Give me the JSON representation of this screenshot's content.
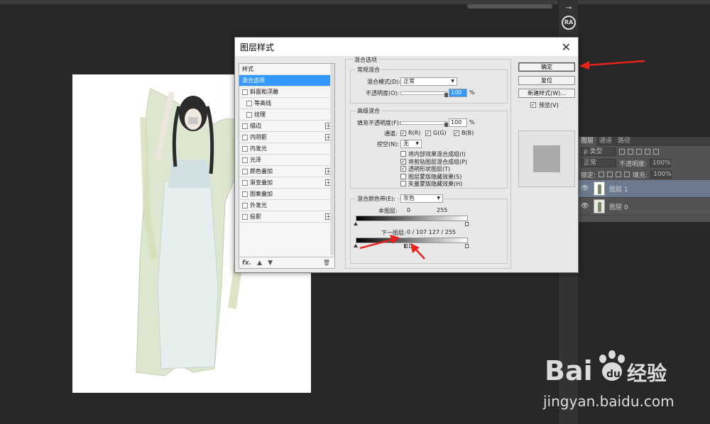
{
  "dialog": {
    "title": "图层样式",
    "close_glyph": "✕",
    "style_list": {
      "items": [
        {
          "label": "样式",
          "checkbox": false,
          "plus": false,
          "selected": false,
          "sub": false
        },
        {
          "label": "混合选项",
          "checkbox": false,
          "plus": false,
          "selected": true,
          "sub": false
        },
        {
          "label": "斜面和浮雕",
          "checkbox": true,
          "plus": false,
          "selected": false,
          "sub": false
        },
        {
          "label": "等高线",
          "checkbox": true,
          "plus": false,
          "selected": false,
          "sub": true
        },
        {
          "label": "纹理",
          "checkbox": true,
          "plus": false,
          "selected": false,
          "sub": true
        },
        {
          "label": "描边",
          "checkbox": true,
          "plus": true,
          "selected": false,
          "sub": false
        },
        {
          "label": "内阴影",
          "checkbox": true,
          "plus": true,
          "selected": false,
          "sub": false
        },
        {
          "label": "内发光",
          "checkbox": true,
          "plus": false,
          "selected": false,
          "sub": false
        },
        {
          "label": "光泽",
          "checkbox": true,
          "plus": false,
          "selected": false,
          "sub": false
        },
        {
          "label": "颜色叠加",
          "checkbox": true,
          "plus": true,
          "selected": false,
          "sub": false
        },
        {
          "label": "渐变叠加",
          "checkbox": true,
          "plus": true,
          "selected": false,
          "sub": false
        },
        {
          "label": "图案叠加",
          "checkbox": true,
          "plus": false,
          "selected": false,
          "sub": false
        },
        {
          "label": "外发光",
          "checkbox": true,
          "plus": false,
          "selected": false,
          "sub": false
        },
        {
          "label": "投影",
          "checkbox": true,
          "plus": true,
          "selected": false,
          "sub": false
        }
      ],
      "footer_fx": "fx.",
      "footer_up": "▲",
      "footer_down": "▼",
      "footer_trash": "🗑"
    },
    "blend": {
      "section_title": "混合选项",
      "general": {
        "title": "常规混合",
        "mode_label": "混合模式(D):",
        "mode_value": "正常",
        "opacity_label": "不透明度(O):",
        "opacity_value": "100",
        "percent": "%"
      },
      "advanced": {
        "title": "高级混合",
        "fill_label": "填充不透明度(F):",
        "fill_value": "100",
        "percent": "%",
        "channels_label": "通道:",
        "channel_r": "R(R)",
        "channel_g": "G(G)",
        "channel_b": "B(B)",
        "knockout_label": "挖空(N):",
        "knockout_value": "无",
        "options": [
          {
            "label": "将内部效果混合成组(I)",
            "checked": false
          },
          {
            "label": "将剪贴图层混合成组(P)",
            "checked": true
          },
          {
            "label": "透明形状图层(T)",
            "checked": true
          },
          {
            "label": "图层蒙版隐藏效果(S)",
            "checked": false
          },
          {
            "label": "矢量蒙版隐藏效果(H)",
            "checked": false
          }
        ]
      },
      "blend_if": {
        "label": "混合颜色带(E):",
        "value": "灰色",
        "this_layer_label": "本图层:",
        "this_layer_low": "0",
        "this_layer_high": "255",
        "underlying_label": "下一图层:",
        "underlying_values": "0  /  107    127  /  255"
      }
    },
    "buttons": {
      "ok": "确定",
      "reset": "复位",
      "new_style": "新建样式(W)...",
      "preview_label": "预览(V)",
      "preview_checked": true
    }
  },
  "layers_panel": {
    "tabs": [
      "图层",
      "通道",
      "路径"
    ],
    "filter_label": "ρ 类型",
    "blend_mode": "正常",
    "opacity_label": "不透明度:",
    "opacity_value": "100%",
    "lock_label": "锁定:",
    "fill_label": "填充:",
    "fill_value": "100%",
    "layers": [
      {
        "name": "图层 1",
        "selected": true
      },
      {
        "name": "图层 0",
        "selected": false
      }
    ]
  },
  "toolstrip": {
    "ra_label": "RA"
  },
  "watermark": {
    "brand": "Bai",
    "brand2": "du",
    "brand_cn": "经验",
    "url": "jingyan.baidu.com"
  },
  "colors": {
    "accent": "#3399ff",
    "arrow": "#e8231d",
    "bg": "#282828"
  }
}
